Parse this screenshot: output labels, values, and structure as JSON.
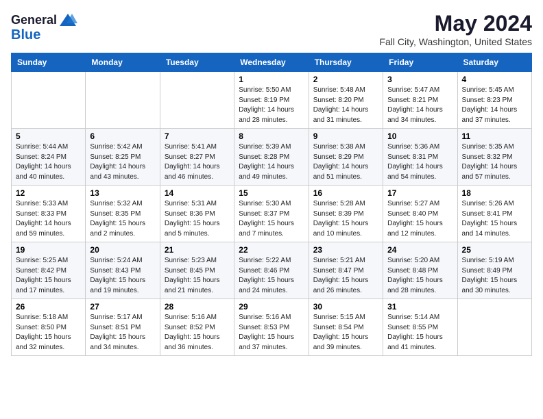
{
  "header": {
    "logo_general": "General",
    "logo_blue": "Blue",
    "month_title": "May 2024",
    "location": "Fall City, Washington, United States"
  },
  "weekdays": [
    "Sunday",
    "Monday",
    "Tuesday",
    "Wednesday",
    "Thursday",
    "Friday",
    "Saturday"
  ],
  "weeks": [
    [
      {
        "day": "",
        "info": ""
      },
      {
        "day": "",
        "info": ""
      },
      {
        "day": "",
        "info": ""
      },
      {
        "day": "1",
        "info": "Sunrise: 5:50 AM\nSunset: 8:19 PM\nDaylight: 14 hours\nand 28 minutes."
      },
      {
        "day": "2",
        "info": "Sunrise: 5:48 AM\nSunset: 8:20 PM\nDaylight: 14 hours\nand 31 minutes."
      },
      {
        "day": "3",
        "info": "Sunrise: 5:47 AM\nSunset: 8:21 PM\nDaylight: 14 hours\nand 34 minutes."
      },
      {
        "day": "4",
        "info": "Sunrise: 5:45 AM\nSunset: 8:23 PM\nDaylight: 14 hours\nand 37 minutes."
      }
    ],
    [
      {
        "day": "5",
        "info": "Sunrise: 5:44 AM\nSunset: 8:24 PM\nDaylight: 14 hours\nand 40 minutes."
      },
      {
        "day": "6",
        "info": "Sunrise: 5:42 AM\nSunset: 8:25 PM\nDaylight: 14 hours\nand 43 minutes."
      },
      {
        "day": "7",
        "info": "Sunrise: 5:41 AM\nSunset: 8:27 PM\nDaylight: 14 hours\nand 46 minutes."
      },
      {
        "day": "8",
        "info": "Sunrise: 5:39 AM\nSunset: 8:28 PM\nDaylight: 14 hours\nand 49 minutes."
      },
      {
        "day": "9",
        "info": "Sunrise: 5:38 AM\nSunset: 8:29 PM\nDaylight: 14 hours\nand 51 minutes."
      },
      {
        "day": "10",
        "info": "Sunrise: 5:36 AM\nSunset: 8:31 PM\nDaylight: 14 hours\nand 54 minutes."
      },
      {
        "day": "11",
        "info": "Sunrise: 5:35 AM\nSunset: 8:32 PM\nDaylight: 14 hours\nand 57 minutes."
      }
    ],
    [
      {
        "day": "12",
        "info": "Sunrise: 5:33 AM\nSunset: 8:33 PM\nDaylight: 14 hours\nand 59 minutes."
      },
      {
        "day": "13",
        "info": "Sunrise: 5:32 AM\nSunset: 8:35 PM\nDaylight: 15 hours\nand 2 minutes."
      },
      {
        "day": "14",
        "info": "Sunrise: 5:31 AM\nSunset: 8:36 PM\nDaylight: 15 hours\nand 5 minutes."
      },
      {
        "day": "15",
        "info": "Sunrise: 5:30 AM\nSunset: 8:37 PM\nDaylight: 15 hours\nand 7 minutes."
      },
      {
        "day": "16",
        "info": "Sunrise: 5:28 AM\nSunset: 8:39 PM\nDaylight: 15 hours\nand 10 minutes."
      },
      {
        "day": "17",
        "info": "Sunrise: 5:27 AM\nSunset: 8:40 PM\nDaylight: 15 hours\nand 12 minutes."
      },
      {
        "day": "18",
        "info": "Sunrise: 5:26 AM\nSunset: 8:41 PM\nDaylight: 15 hours\nand 14 minutes."
      }
    ],
    [
      {
        "day": "19",
        "info": "Sunrise: 5:25 AM\nSunset: 8:42 PM\nDaylight: 15 hours\nand 17 minutes."
      },
      {
        "day": "20",
        "info": "Sunrise: 5:24 AM\nSunset: 8:43 PM\nDaylight: 15 hours\nand 19 minutes."
      },
      {
        "day": "21",
        "info": "Sunrise: 5:23 AM\nSunset: 8:45 PM\nDaylight: 15 hours\nand 21 minutes."
      },
      {
        "day": "22",
        "info": "Sunrise: 5:22 AM\nSunset: 8:46 PM\nDaylight: 15 hours\nand 24 minutes."
      },
      {
        "day": "23",
        "info": "Sunrise: 5:21 AM\nSunset: 8:47 PM\nDaylight: 15 hours\nand 26 minutes."
      },
      {
        "day": "24",
        "info": "Sunrise: 5:20 AM\nSunset: 8:48 PM\nDaylight: 15 hours\nand 28 minutes."
      },
      {
        "day": "25",
        "info": "Sunrise: 5:19 AM\nSunset: 8:49 PM\nDaylight: 15 hours\nand 30 minutes."
      }
    ],
    [
      {
        "day": "26",
        "info": "Sunrise: 5:18 AM\nSunset: 8:50 PM\nDaylight: 15 hours\nand 32 minutes."
      },
      {
        "day": "27",
        "info": "Sunrise: 5:17 AM\nSunset: 8:51 PM\nDaylight: 15 hours\nand 34 minutes."
      },
      {
        "day": "28",
        "info": "Sunrise: 5:16 AM\nSunset: 8:52 PM\nDaylight: 15 hours\nand 36 minutes."
      },
      {
        "day": "29",
        "info": "Sunrise: 5:16 AM\nSunset: 8:53 PM\nDaylight: 15 hours\nand 37 minutes."
      },
      {
        "day": "30",
        "info": "Sunrise: 5:15 AM\nSunset: 8:54 PM\nDaylight: 15 hours\nand 39 minutes."
      },
      {
        "day": "31",
        "info": "Sunrise: 5:14 AM\nSunset: 8:55 PM\nDaylight: 15 hours\nand 41 minutes."
      },
      {
        "day": "",
        "info": ""
      }
    ]
  ]
}
